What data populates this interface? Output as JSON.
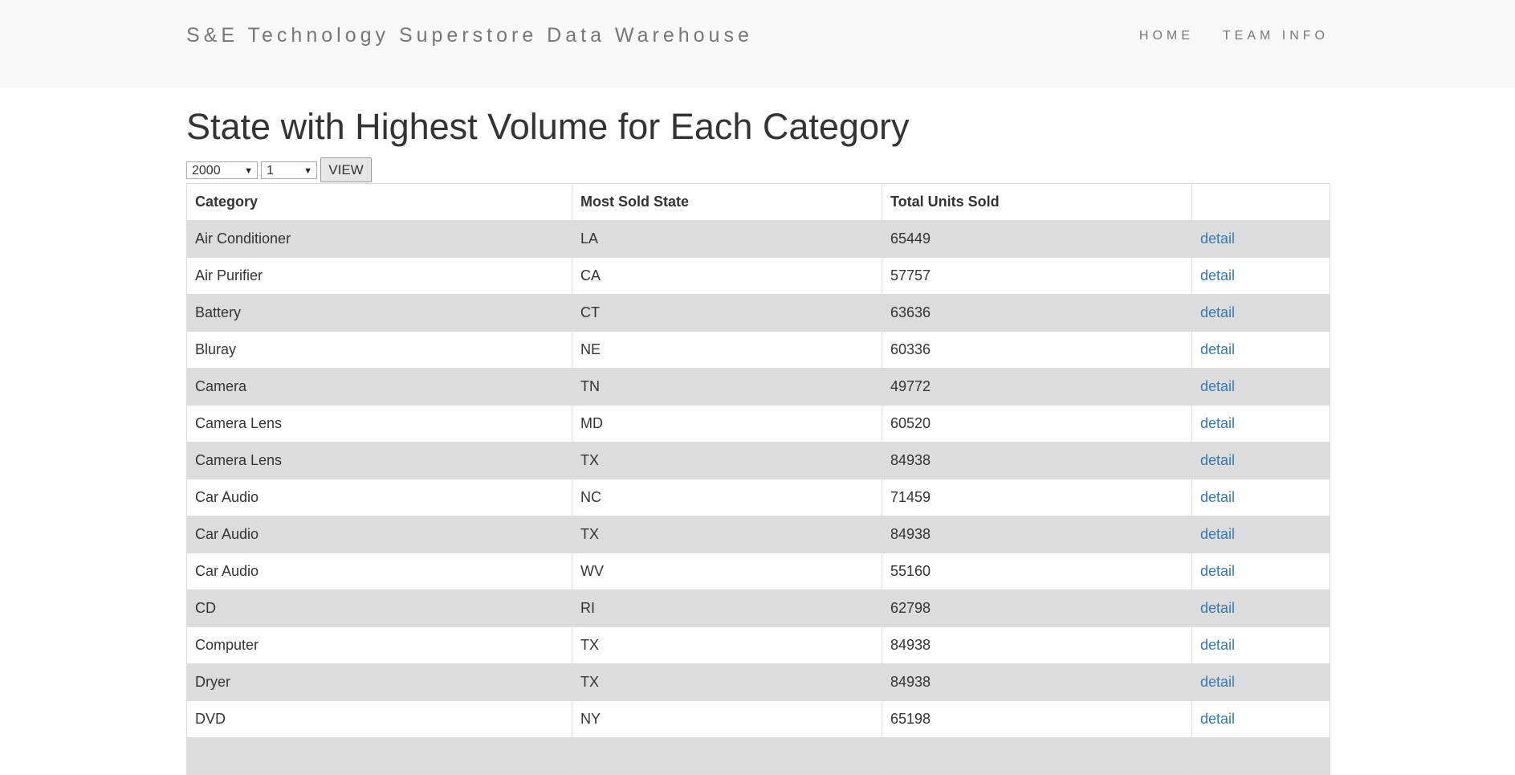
{
  "header": {
    "brand": "S&E Technology Superstore Data Warehouse",
    "nav": [
      "HOME",
      "TEAM INFO"
    ]
  },
  "page": {
    "title": "State with Highest Volume for Each Category"
  },
  "filters": {
    "year": "2000",
    "month": "1",
    "view_label": "VIEW"
  },
  "table": {
    "columns": [
      "Category",
      "Most Sold State",
      "Total Units Sold",
      ""
    ],
    "rows": [
      {
        "category": "Air Conditioner",
        "state": "LA",
        "units": "65449",
        "link": "detail"
      },
      {
        "category": "Air Purifier",
        "state": "CA",
        "units": "57757",
        "link": "detail"
      },
      {
        "category": "Battery",
        "state": "CT",
        "units": "63636",
        "link": "detail"
      },
      {
        "category": "Bluray",
        "state": "NE",
        "units": "60336",
        "link": "detail"
      },
      {
        "category": "Camera",
        "state": "TN",
        "units": "49772",
        "link": "detail"
      },
      {
        "category": "Camera Lens",
        "state": "MD",
        "units": "60520",
        "link": "detail"
      },
      {
        "category": "Camera Lens",
        "state": "TX",
        "units": "84938",
        "link": "detail"
      },
      {
        "category": "Car Audio",
        "state": "NC",
        "units": "71459",
        "link": "detail"
      },
      {
        "category": "Car Audio",
        "state": "TX",
        "units": "84938",
        "link": "detail"
      },
      {
        "category": "Car Audio",
        "state": "WV",
        "units": "55160",
        "link": "detail"
      },
      {
        "category": "CD",
        "state": "RI",
        "units": "62798",
        "link": "detail"
      },
      {
        "category": "Computer",
        "state": "TX",
        "units": "84938",
        "link": "detail"
      },
      {
        "category": "Dryer",
        "state": "TX",
        "units": "84938",
        "link": "detail"
      },
      {
        "category": "DVD",
        "state": "NY",
        "units": "65198",
        "link": "detail"
      }
    ]
  },
  "colors": {
    "link": "#337ab7",
    "stripe": "#dcdcdc",
    "navbar_bg": "#f8f8f8"
  }
}
